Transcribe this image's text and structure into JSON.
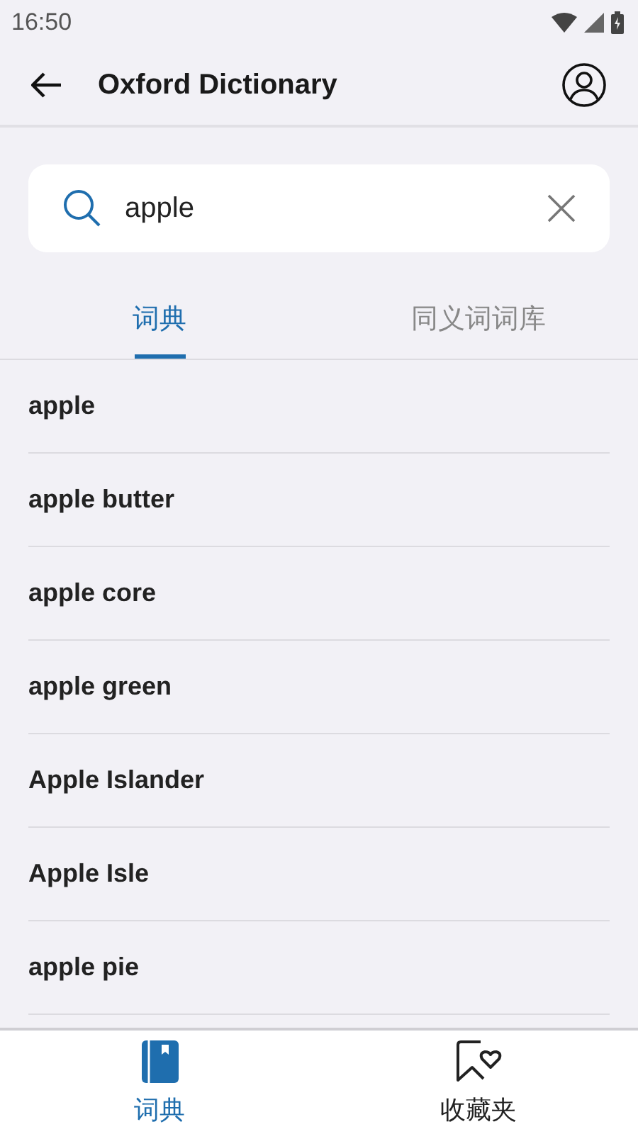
{
  "status_bar": {
    "time": "16:50"
  },
  "app_bar": {
    "title": "Oxford Dictionary"
  },
  "search": {
    "value": "apple"
  },
  "tabs": [
    {
      "label": "词典",
      "selected": true
    },
    {
      "label": "同义词词库",
      "selected": false
    }
  ],
  "results": [
    "apple",
    "apple butter",
    "apple core",
    "apple green",
    "Apple Islander",
    "Apple Isle",
    "apple pie"
  ],
  "bottom_nav": [
    {
      "label": "词典",
      "kind": "book",
      "selected": true
    },
    {
      "label": "收藏夹",
      "kind": "favorites",
      "selected": false
    }
  ]
}
